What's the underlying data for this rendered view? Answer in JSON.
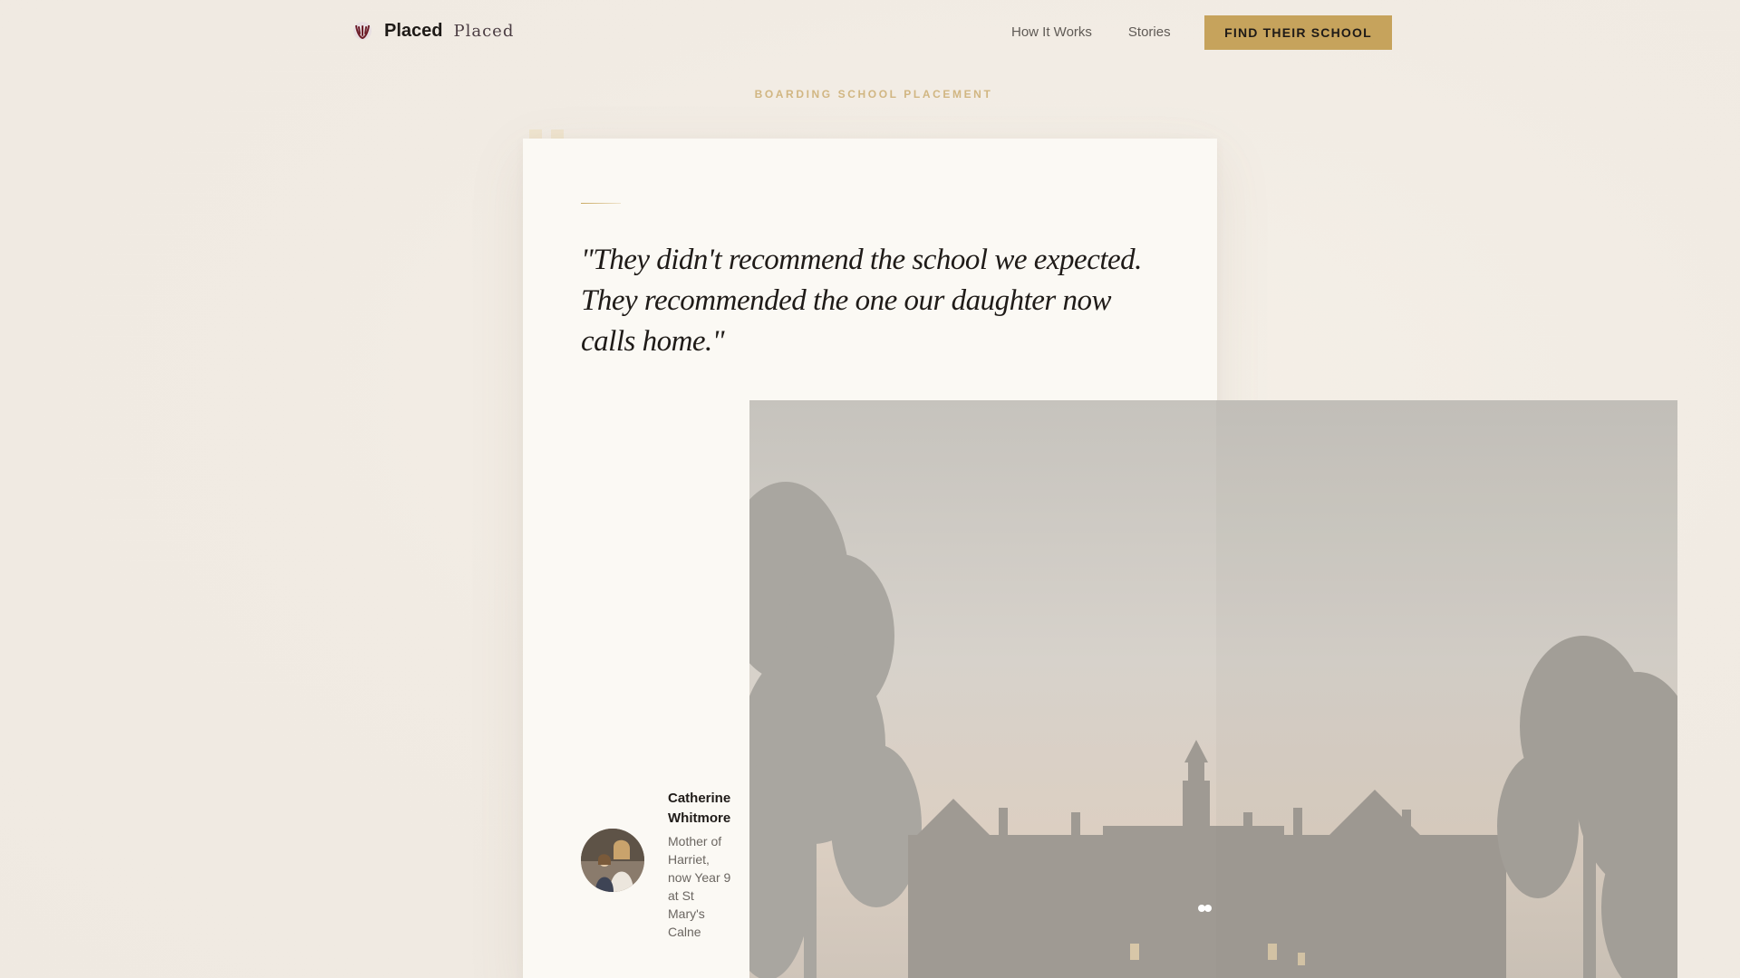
{
  "nav": {
    "brand_name": "Placed",
    "brand_sub": "Placed",
    "links": [
      "How It Works",
      "Stories"
    ],
    "cta": "FIND THEIR SCHOOL"
  },
  "hero": {
    "eyebrow": "BOARDING SCHOOL PLACEMENT"
  },
  "testimonial": {
    "quote": "\"They didn't recommend the school we expected. They recommended the one our daughter now calls home.\"",
    "author_name": "Catherine Whitmore",
    "author_role": "Mother of Harriet, now Year 9 at St Mary's Calne"
  },
  "colors": {
    "accent": "#c6a35c",
    "card": "#fbf9f4",
    "text": "#1f1b18"
  },
  "icons": {
    "brand": "crest-icon"
  }
}
